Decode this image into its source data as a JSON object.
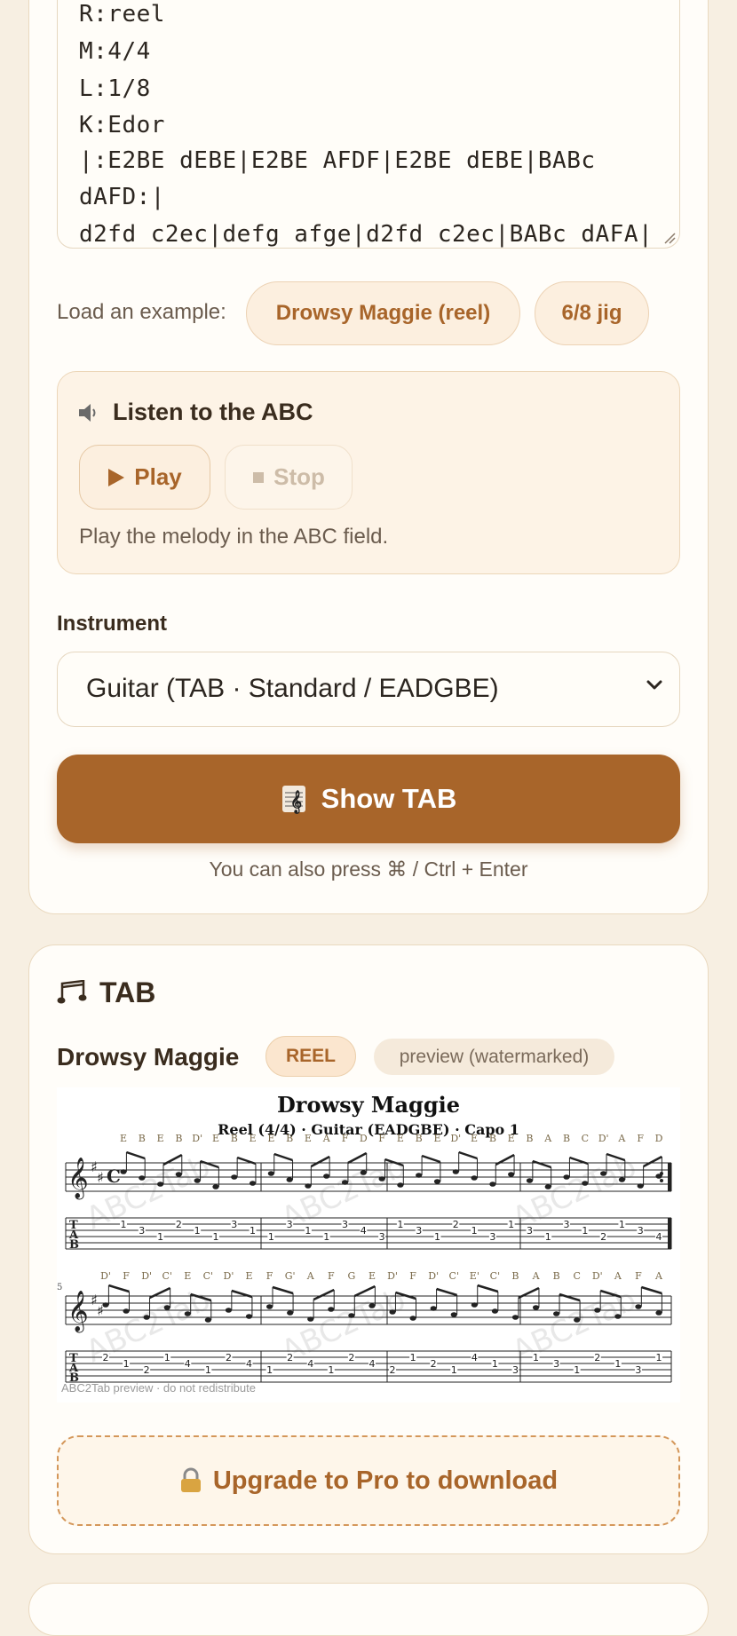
{
  "abc_input": {
    "lines": [
      "R:reel",
      "M:4/4",
      "L:1/8",
      "K:Edor",
      "|:E2BE dEBE|E2BE AFDF|E2BE dEBE|BABc",
      "dAFD:|",
      "d2fd c2ec|defg afge|d2fd c2ec|BABc dAFA|"
    ]
  },
  "examples": {
    "label": "Load an example:",
    "buttons": [
      "Drowsy Maggie (reel)",
      "6/8 jig"
    ]
  },
  "listen": {
    "icon": "speaker-icon",
    "title": "Listen to the ABC",
    "play_label": "Play",
    "stop_label": "Stop",
    "hint": "Play the melody in the ABC field."
  },
  "instrument": {
    "label": "Instrument",
    "selected": "Guitar (TAB · Standard / EADGBE)"
  },
  "action": {
    "show_tab_label": "Show TAB",
    "shortcut_hint": "You can also press ⌘ / Ctrl + Enter"
  },
  "tab_section": {
    "heading": "TAB",
    "tune_title": "Drowsy Maggie",
    "type_badge": "REEL",
    "preview_badge": "preview (watermarked)",
    "score_title": "Drowsy Maggie",
    "score_subtitle": "Reel (4/4) · Guitar (EADGBE) · Capo 1",
    "footer_watermark": "ABC2Tab preview · do not redistribute",
    "watermark_text": "ABC2Tab",
    "system1": {
      "note_names": [
        "E",
        "B",
        "E",
        "B",
        "D'",
        "E",
        "B",
        "E",
        "E",
        "B",
        "E",
        "A",
        "F",
        "D",
        "F",
        "E",
        "B",
        "E",
        "D'",
        "E",
        "B",
        "E",
        "B",
        "A",
        "B",
        "C",
        "D'",
        "A",
        "F",
        "D"
      ],
      "tab_numbers": [
        "1",
        "3",
        "1",
        "2",
        "1",
        "1",
        "3",
        "1",
        "1",
        "3",
        "1",
        "1",
        "3",
        "4",
        "3",
        "1",
        "3",
        "1",
        "2",
        "1",
        "3",
        "1",
        "3",
        "1",
        "3",
        "1",
        "2",
        "1",
        "3",
        "4"
      ]
    },
    "system2": {
      "measure_number": "5",
      "note_names": [
        "D'",
        "F",
        "D'",
        "C'",
        "E",
        "C'",
        "D'",
        "E",
        "F",
        "G'",
        "A",
        "F",
        "G",
        "E",
        "D'",
        "F",
        "D'",
        "C'",
        "E'",
        "C'",
        "B",
        "A",
        "B",
        "C",
        "D'",
        "A",
        "F",
        "A"
      ],
      "tab_numbers": [
        "2",
        "1",
        "2",
        "1",
        "4",
        "1",
        "2",
        "4",
        "1",
        "2",
        "4",
        "1",
        "2",
        "4",
        "2",
        "1",
        "2",
        "1",
        "4",
        "1",
        "3",
        "1",
        "3",
        "1",
        "2",
        "1",
        "3",
        "1"
      ]
    }
  },
  "upgrade": {
    "label": "Upgrade to Pro to download"
  }
}
